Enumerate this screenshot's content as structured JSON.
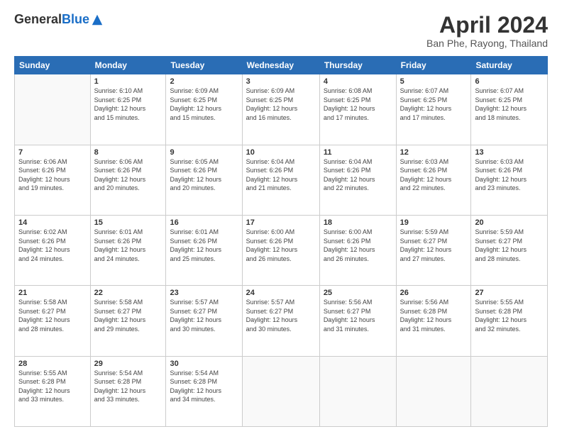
{
  "header": {
    "logo_general": "General",
    "logo_blue": "Blue",
    "month": "April 2024",
    "location": "Ban Phe, Rayong, Thailand"
  },
  "weekdays": [
    "Sunday",
    "Monday",
    "Tuesday",
    "Wednesday",
    "Thursday",
    "Friday",
    "Saturday"
  ],
  "weeks": [
    [
      {
        "day": "",
        "info": ""
      },
      {
        "day": "1",
        "info": "Sunrise: 6:10 AM\nSunset: 6:25 PM\nDaylight: 12 hours\nand 15 minutes."
      },
      {
        "day": "2",
        "info": "Sunrise: 6:09 AM\nSunset: 6:25 PM\nDaylight: 12 hours\nand 15 minutes."
      },
      {
        "day": "3",
        "info": "Sunrise: 6:09 AM\nSunset: 6:25 PM\nDaylight: 12 hours\nand 16 minutes."
      },
      {
        "day": "4",
        "info": "Sunrise: 6:08 AM\nSunset: 6:25 PM\nDaylight: 12 hours\nand 17 minutes."
      },
      {
        "day": "5",
        "info": "Sunrise: 6:07 AM\nSunset: 6:25 PM\nDaylight: 12 hours\nand 17 minutes."
      },
      {
        "day": "6",
        "info": "Sunrise: 6:07 AM\nSunset: 6:25 PM\nDaylight: 12 hours\nand 18 minutes."
      }
    ],
    [
      {
        "day": "7",
        "info": "Sunrise: 6:06 AM\nSunset: 6:26 PM\nDaylight: 12 hours\nand 19 minutes."
      },
      {
        "day": "8",
        "info": "Sunrise: 6:06 AM\nSunset: 6:26 PM\nDaylight: 12 hours\nand 20 minutes."
      },
      {
        "day": "9",
        "info": "Sunrise: 6:05 AM\nSunset: 6:26 PM\nDaylight: 12 hours\nand 20 minutes."
      },
      {
        "day": "10",
        "info": "Sunrise: 6:04 AM\nSunset: 6:26 PM\nDaylight: 12 hours\nand 21 minutes."
      },
      {
        "day": "11",
        "info": "Sunrise: 6:04 AM\nSunset: 6:26 PM\nDaylight: 12 hours\nand 22 minutes."
      },
      {
        "day": "12",
        "info": "Sunrise: 6:03 AM\nSunset: 6:26 PM\nDaylight: 12 hours\nand 22 minutes."
      },
      {
        "day": "13",
        "info": "Sunrise: 6:03 AM\nSunset: 6:26 PM\nDaylight: 12 hours\nand 23 minutes."
      }
    ],
    [
      {
        "day": "14",
        "info": "Sunrise: 6:02 AM\nSunset: 6:26 PM\nDaylight: 12 hours\nand 24 minutes."
      },
      {
        "day": "15",
        "info": "Sunrise: 6:01 AM\nSunset: 6:26 PM\nDaylight: 12 hours\nand 24 minutes."
      },
      {
        "day": "16",
        "info": "Sunrise: 6:01 AM\nSunset: 6:26 PM\nDaylight: 12 hours\nand 25 minutes."
      },
      {
        "day": "17",
        "info": "Sunrise: 6:00 AM\nSunset: 6:26 PM\nDaylight: 12 hours\nand 26 minutes."
      },
      {
        "day": "18",
        "info": "Sunrise: 6:00 AM\nSunset: 6:26 PM\nDaylight: 12 hours\nand 26 minutes."
      },
      {
        "day": "19",
        "info": "Sunrise: 5:59 AM\nSunset: 6:27 PM\nDaylight: 12 hours\nand 27 minutes."
      },
      {
        "day": "20",
        "info": "Sunrise: 5:59 AM\nSunset: 6:27 PM\nDaylight: 12 hours\nand 28 minutes."
      }
    ],
    [
      {
        "day": "21",
        "info": "Sunrise: 5:58 AM\nSunset: 6:27 PM\nDaylight: 12 hours\nand 28 minutes."
      },
      {
        "day": "22",
        "info": "Sunrise: 5:58 AM\nSunset: 6:27 PM\nDaylight: 12 hours\nand 29 minutes."
      },
      {
        "day": "23",
        "info": "Sunrise: 5:57 AM\nSunset: 6:27 PM\nDaylight: 12 hours\nand 30 minutes."
      },
      {
        "day": "24",
        "info": "Sunrise: 5:57 AM\nSunset: 6:27 PM\nDaylight: 12 hours\nand 30 minutes."
      },
      {
        "day": "25",
        "info": "Sunrise: 5:56 AM\nSunset: 6:27 PM\nDaylight: 12 hours\nand 31 minutes."
      },
      {
        "day": "26",
        "info": "Sunrise: 5:56 AM\nSunset: 6:28 PM\nDaylight: 12 hours\nand 31 minutes."
      },
      {
        "day": "27",
        "info": "Sunrise: 5:55 AM\nSunset: 6:28 PM\nDaylight: 12 hours\nand 32 minutes."
      }
    ],
    [
      {
        "day": "28",
        "info": "Sunrise: 5:55 AM\nSunset: 6:28 PM\nDaylight: 12 hours\nand 33 minutes."
      },
      {
        "day": "29",
        "info": "Sunrise: 5:54 AM\nSunset: 6:28 PM\nDaylight: 12 hours\nand 33 minutes."
      },
      {
        "day": "30",
        "info": "Sunrise: 5:54 AM\nSunset: 6:28 PM\nDaylight: 12 hours\nand 34 minutes."
      },
      {
        "day": "",
        "info": ""
      },
      {
        "day": "",
        "info": ""
      },
      {
        "day": "",
        "info": ""
      },
      {
        "day": "",
        "info": ""
      }
    ]
  ]
}
